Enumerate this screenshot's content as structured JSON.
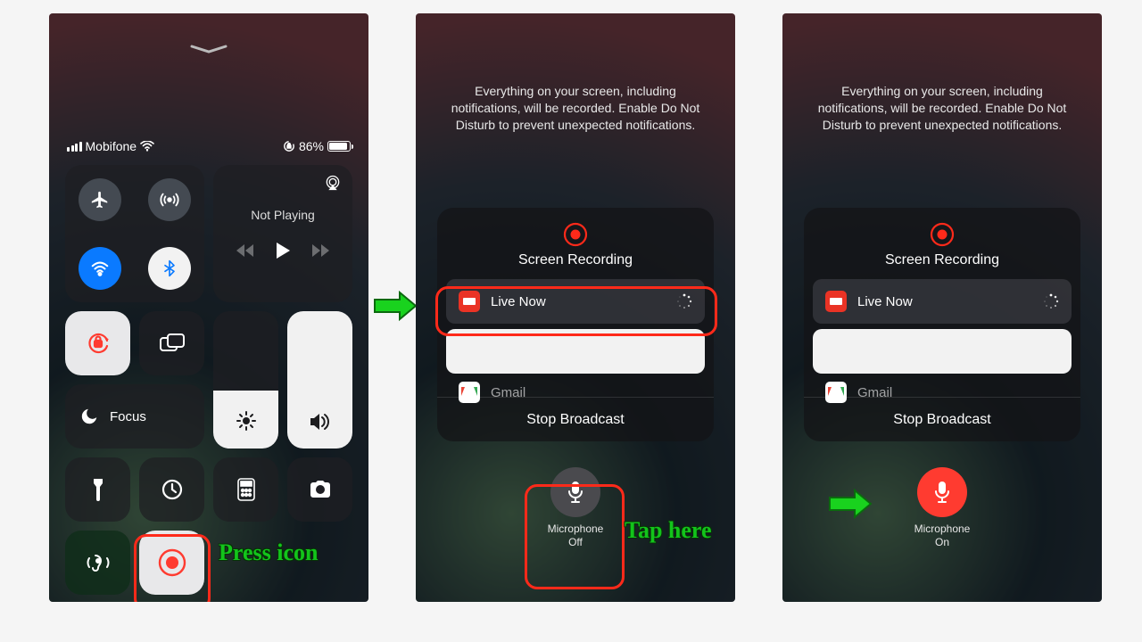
{
  "status": {
    "carrier": "Mobifone",
    "battery_percent": "86%"
  },
  "control_center": {
    "not_playing": "Not Playing",
    "focus": "Focus"
  },
  "recording": {
    "disclaimer": "Everything on your screen, including notifications, will be recorded. Enable Do Not Disturb to prevent unexpected notifications.",
    "title": "Screen Recording",
    "app_live_now": "Live Now",
    "app_gmail": "Gmail",
    "stop": "Stop Broadcast",
    "mic_label": "Microphone",
    "mic_off": "Off",
    "mic_on": "On"
  },
  "annotations": {
    "press_icon": "Press icon",
    "tap_here": "Tap here"
  }
}
